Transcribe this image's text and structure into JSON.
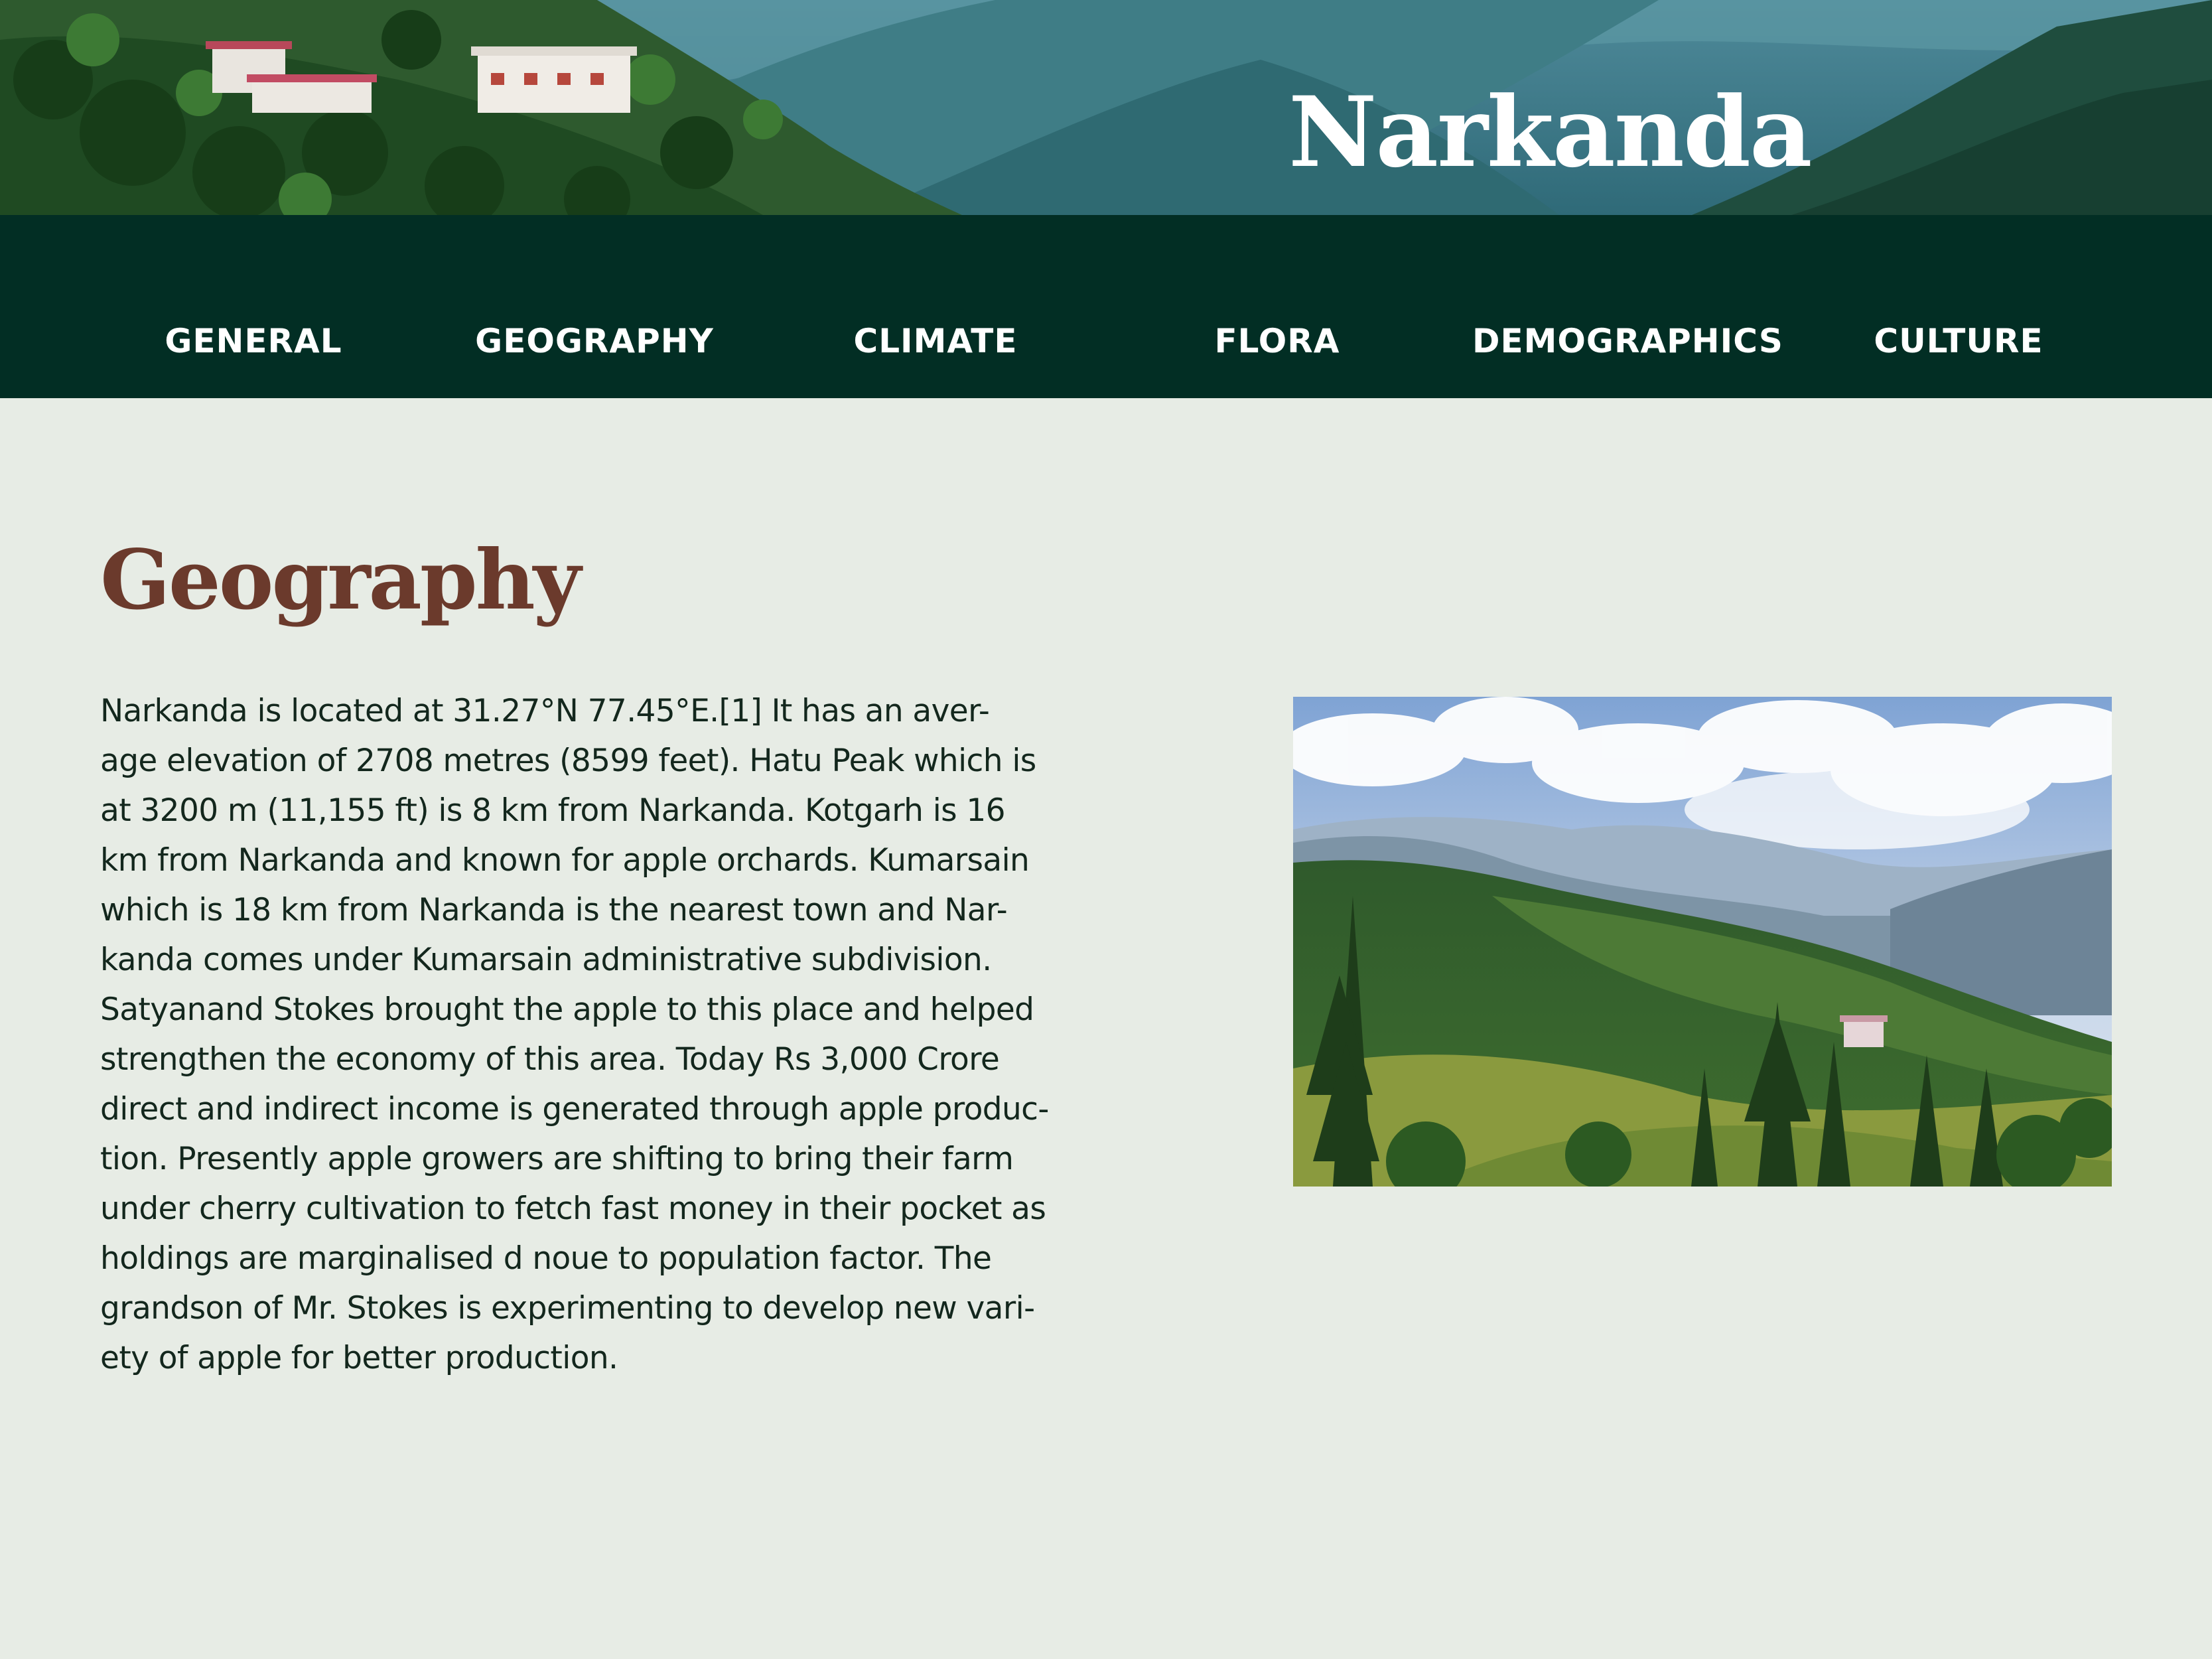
{
  "header": {
    "title": "Narkanda",
    "banner_image": "mountain-village-banner"
  },
  "nav": {
    "items": [
      {
        "label": "GENERAL"
      },
      {
        "label": "GEOGRAPHY"
      },
      {
        "label": "CLIMATE"
      },
      {
        "label": "FLORA"
      },
      {
        "label": "DEMOGRAPHICS"
      },
      {
        "label": "CULTURE"
      }
    ]
  },
  "section": {
    "title": "Geography",
    "lines": [
      "Narkanda is located at 31.27°N 77.45°E.[1] It has an aver-",
      "age elevation of 2708 metres (8599 feet). Hatu Peak which is",
      "at 3200 m (11,155 ft) is 8 km from Narkanda. Kotgarh is 16",
      "km from Narkanda and known for apple orchards. Kumarsain",
      "which is 18 km from Narkanda is the nearest town and Nar-",
      "kanda comes under Kumarsain administrative subdivision.",
      "Satyanand Stokes brought the apple to this place and helped",
      "strengthen the economy of this area. Today Rs 3,000 Crore",
      "direct and indirect income is generated through apple produc-",
      "tion. Presently apple growers are shifting to bring their farm",
      "under cherry cultivation to fetch fast money in their pocket as",
      "holdings are marginalised d noue to population factor. The",
      "grandson of Mr. Stokes is experimenting to develop new vari-",
      "ety of apple for better production."
    ],
    "photo": "mountain-valley-photo"
  },
  "colors": {
    "nav_background": "#022e24",
    "page_background": "#e7ece5",
    "heading": "#6b3a2c",
    "body_text": "#13271d",
    "title_text": "#ffffff"
  }
}
